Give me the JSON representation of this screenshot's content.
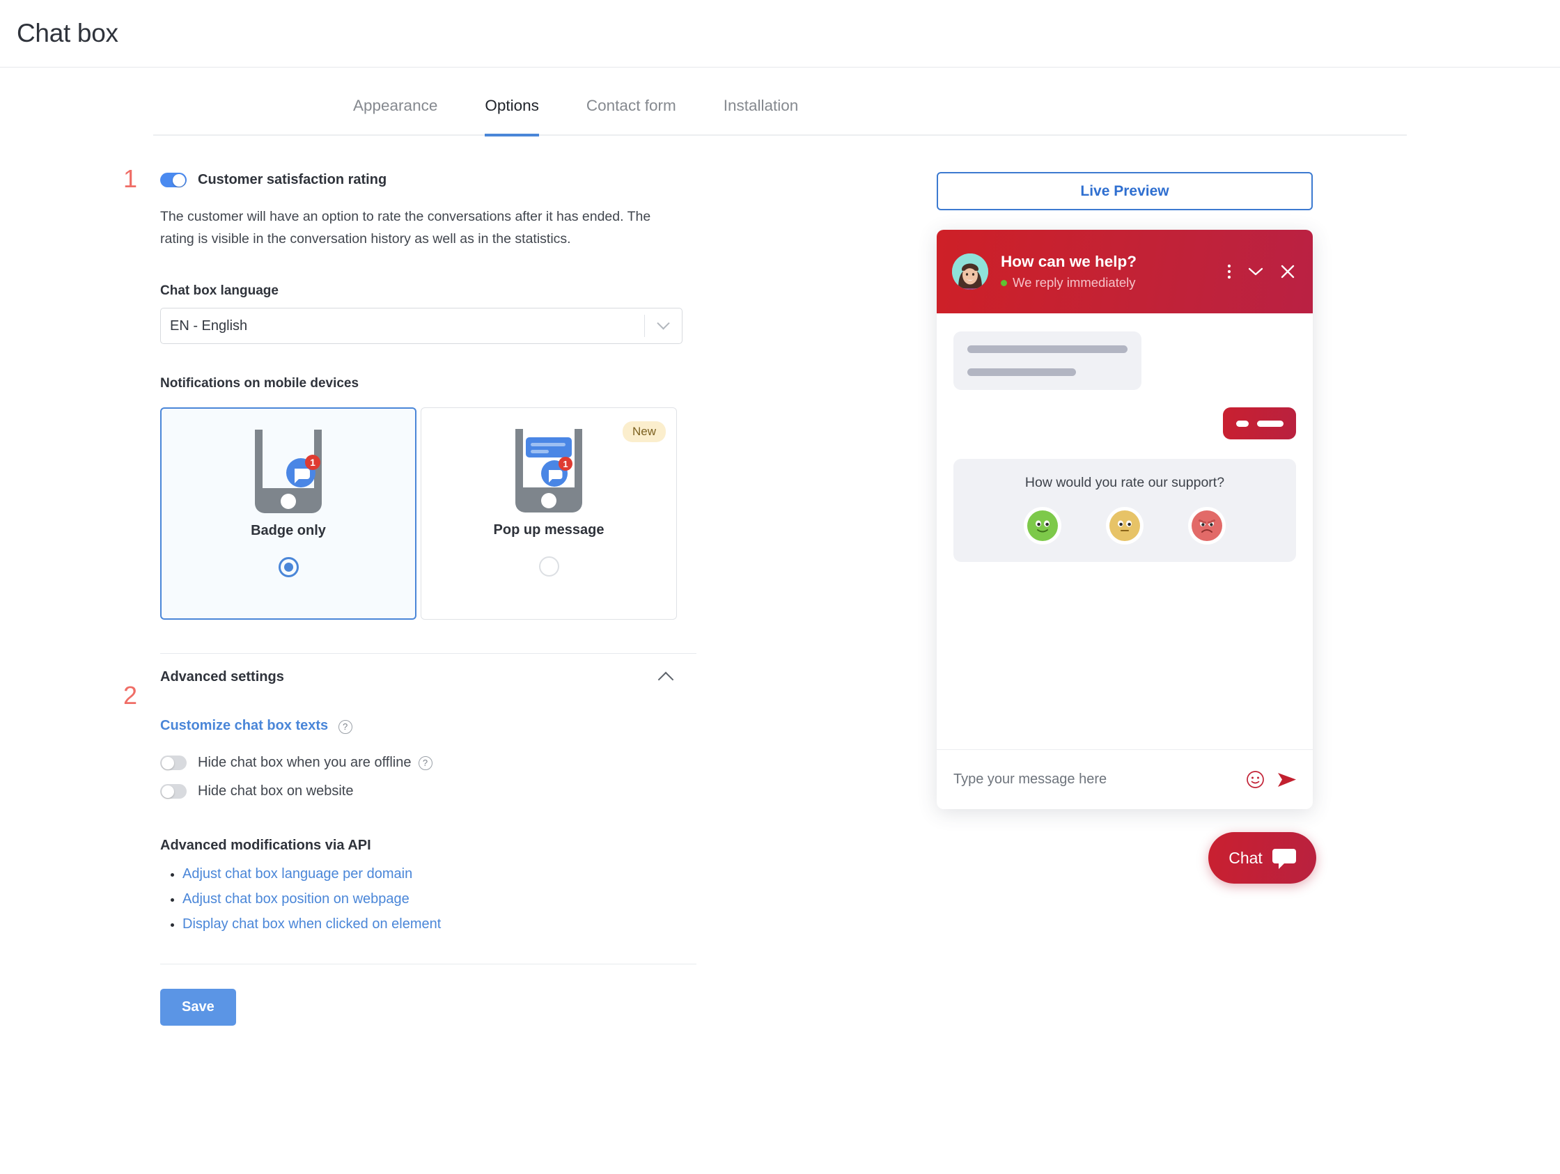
{
  "header": {
    "title": "Chat box"
  },
  "tabs": [
    {
      "label": "Appearance",
      "active": false
    },
    {
      "label": "Options",
      "active": true
    },
    {
      "label": "Contact form",
      "active": false
    },
    {
      "label": "Installation",
      "active": false
    }
  ],
  "steps": {
    "one": "1",
    "two": "2"
  },
  "settings": {
    "csat": {
      "label": "Customer satisfaction rating",
      "enabled": true,
      "description": "The customer will have an option to rate the conversations after it has ended. The rating is visible in the conversation history as well as in the statistics."
    },
    "language": {
      "label": "Chat box language",
      "value": "EN - English"
    },
    "notifications": {
      "label": "Notifications on mobile devices",
      "options": [
        {
          "title": "Badge only",
          "selected": true,
          "badge": ""
        },
        {
          "title": "Pop up message",
          "selected": false,
          "badge": "New"
        }
      ]
    }
  },
  "advanced": {
    "title": "Advanced settings",
    "expanded": true,
    "customize_link": "Customize chat box texts",
    "toggles": [
      {
        "label": "Hide chat box when you are offline",
        "enabled": false,
        "help": true
      },
      {
        "label": "Hide chat box on website",
        "enabled": false,
        "help": false
      }
    ],
    "api_title": "Advanced modifications via API",
    "api_links": [
      "Adjust chat box language per domain",
      "Adjust chat box position on webpage",
      "Display chat box when clicked on element"
    ]
  },
  "save_button": "Save",
  "preview": {
    "live_preview_label": "Live Preview",
    "widget": {
      "title": "How can we help?",
      "status": "We reply immediately",
      "rating_question": "How would you rate our support?",
      "faces": [
        {
          "name": "happy",
          "color": "#7dc94a"
        },
        {
          "name": "neutral",
          "color": "#e7c367"
        },
        {
          "name": "sad",
          "color": "#e26a68"
        }
      ],
      "input_placeholder": "Type your message here"
    },
    "fab_label": "Chat"
  },
  "colors": {
    "accent_blue": "#4a86d8",
    "brand_red": "#c22236",
    "step_red": "#ef6d66",
    "badge_bg": "#fbeecd"
  }
}
